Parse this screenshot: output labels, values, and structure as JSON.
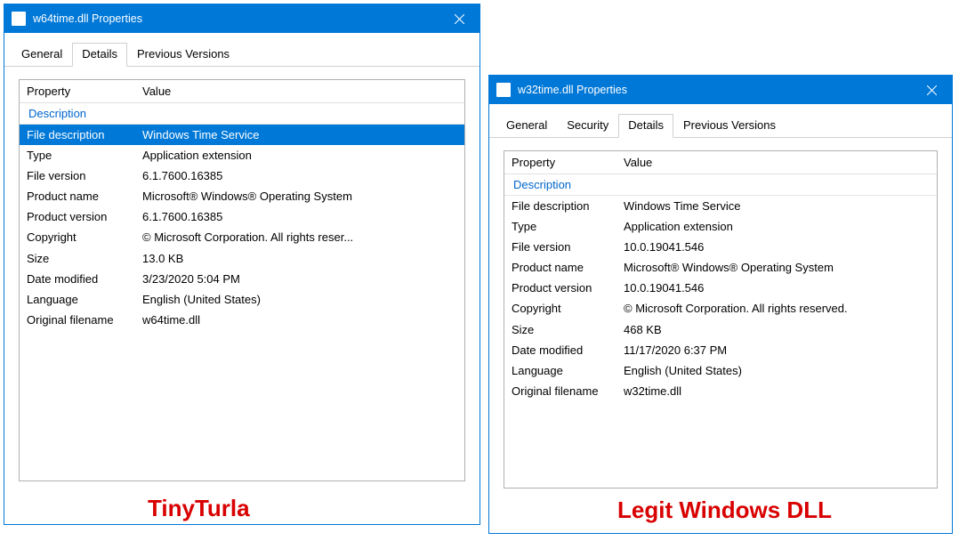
{
  "left": {
    "title": "w64time.dll Properties",
    "tabs": [
      "General",
      "Details",
      "Previous Versions"
    ],
    "activeTab": 1,
    "header": {
      "prop": "Property",
      "val": "Value"
    },
    "group": "Description",
    "rows": [
      {
        "p": "File description",
        "v": "Windows Time Service",
        "sel": true
      },
      {
        "p": "Type",
        "v": "Application extension"
      },
      {
        "p": "File version",
        "v": "6.1.7600.16385"
      },
      {
        "p": "Product name",
        "v": "Microsoft® Windows® Operating System"
      },
      {
        "p": "Product version",
        "v": "6.1.7600.16385"
      },
      {
        "p": "Copyright",
        "v": "© Microsoft Corporation. All rights reser..."
      },
      {
        "p": "Size",
        "v": "13.0 KB"
      },
      {
        "p": "Date modified",
        "v": "3/23/2020 5:04 PM"
      },
      {
        "p": "Language",
        "v": "English (United States)"
      },
      {
        "p": "Original filename",
        "v": "w64time.dll"
      }
    ],
    "caption": "TinyTurla"
  },
  "right": {
    "title": "w32time.dll Properties",
    "tabs": [
      "General",
      "Security",
      "Details",
      "Previous Versions"
    ],
    "activeTab": 2,
    "header": {
      "prop": "Property",
      "val": "Value"
    },
    "group": "Description",
    "rows": [
      {
        "p": "File description",
        "v": "Windows Time Service"
      },
      {
        "p": "Type",
        "v": "Application extension"
      },
      {
        "p": "File version",
        "v": "10.0.19041.546"
      },
      {
        "p": "Product name",
        "v": "Microsoft® Windows® Operating System"
      },
      {
        "p": "Product version",
        "v": "10.0.19041.546"
      },
      {
        "p": "Copyright",
        "v": "© Microsoft Corporation. All rights reserved."
      },
      {
        "p": "Size",
        "v": "468 KB"
      },
      {
        "p": "Date modified",
        "v": "11/17/2020 6:37 PM"
      },
      {
        "p": "Language",
        "v": "English (United States)"
      },
      {
        "p": "Original filename",
        "v": "w32time.dll"
      }
    ],
    "caption": "Legit Windows DLL"
  }
}
